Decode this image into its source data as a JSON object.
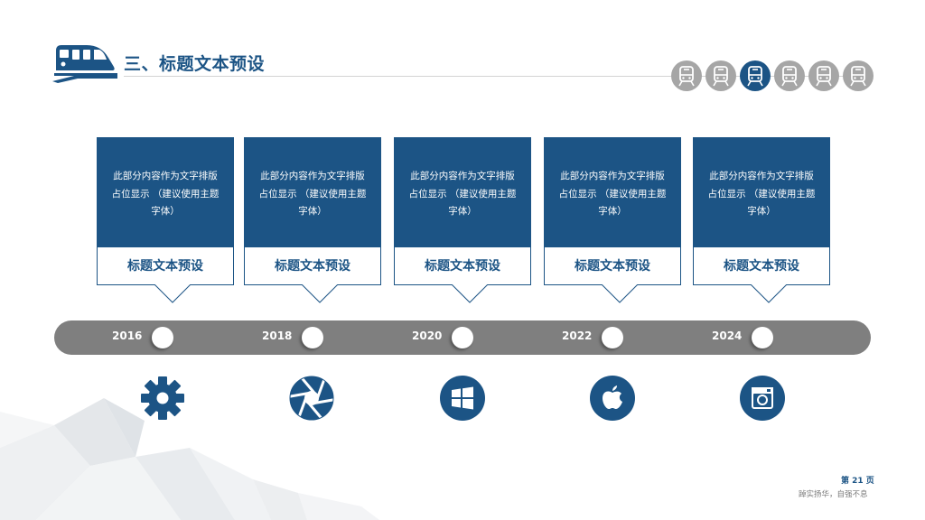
{
  "header": {
    "title": "三、标题文本预设"
  },
  "nav": {
    "items": [
      {
        "icon": "train-icon",
        "active": false
      },
      {
        "icon": "train-icon",
        "active": false
      },
      {
        "icon": "train-icon",
        "active": true
      },
      {
        "icon": "train-icon",
        "active": false
      },
      {
        "icon": "train-icon",
        "active": false
      },
      {
        "icon": "train-icon",
        "active": false
      }
    ]
  },
  "cards": [
    {
      "lines": [
        "此部分内容作为文字排版",
        "占位显示 （建议使用主题",
        "字体）"
      ],
      "title": "标题文本预设"
    },
    {
      "lines": [
        "此部分内容作为文字排版",
        "占位显示 （建议使用主题",
        "字体）"
      ],
      "title": "标题文本预设"
    },
    {
      "lines": [
        "此部分内容作为文字排版",
        "占位显示 （建议使用主题",
        "字体）"
      ],
      "title": "标题文本预设"
    },
    {
      "lines": [
        "此部分内容作为文字排版",
        "占位显示 （建议使用主题",
        "字体）"
      ],
      "title": "标题文本预设"
    },
    {
      "lines": [
        "此部分内容作为文字排版",
        "占位显示 （建议使用主题",
        "字体）"
      ],
      "title": "标题文本预设"
    }
  ],
  "timeline": {
    "years": [
      "2016",
      "2018",
      "2020",
      "2022",
      "2024"
    ]
  },
  "icons": [
    "gear-icon",
    "camera-aperture-icon",
    "windows-icon",
    "apple-icon",
    "instagram-icon"
  ],
  "footer": {
    "page": "第 21 页",
    "slogan": "踔实扬华，自强不息"
  },
  "colors": {
    "primary": "#1c5485",
    "timeline": "#7f7f7f",
    "inactive_nav": "#a6a6a6"
  }
}
